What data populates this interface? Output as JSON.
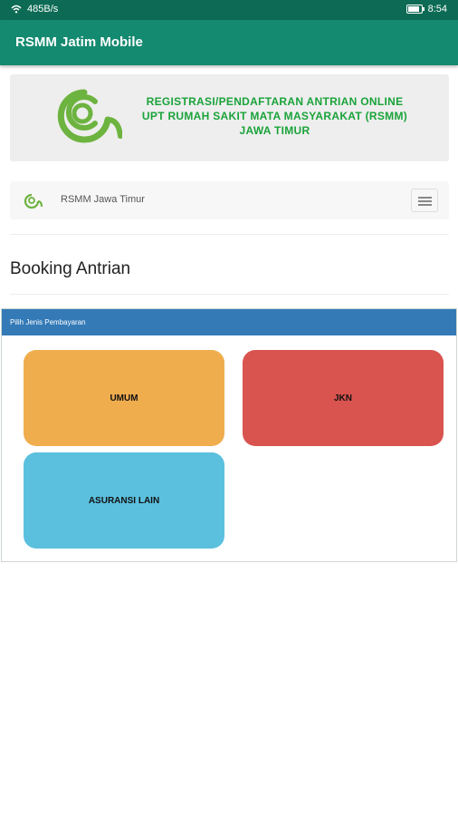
{
  "status_bar": {
    "network_speed": "485B/s",
    "time": "8:54",
    "battery_level": 0.8
  },
  "app_bar": {
    "title": "RSMM Jatim Mobile"
  },
  "banner": {
    "lines": [
      "REGISTRASI/PENDAFTARAN ANTRIAN ONLINE",
      "UPT RUMAH SAKIT MATA MASYARAKAT (RSMM)",
      "JAWA TIMUR"
    ]
  },
  "navbar": {
    "brand": "RSMM Jawa Timur"
  },
  "page": {
    "heading": "Booking Antrian"
  },
  "payment_panel": {
    "title": "Pilih Jenis Pembayaran",
    "options": [
      "UMUM",
      "JKN",
      "ASURANSI LAIN"
    ]
  },
  "colors": {
    "status_bar": "#0d6b55",
    "app_bar": "#148a70",
    "banner_text": "#1aa33a",
    "panel_header": "#337ab7",
    "umum": "#f0ad4e",
    "jkn": "#d9534f",
    "asuransi": "#5bc0de"
  }
}
